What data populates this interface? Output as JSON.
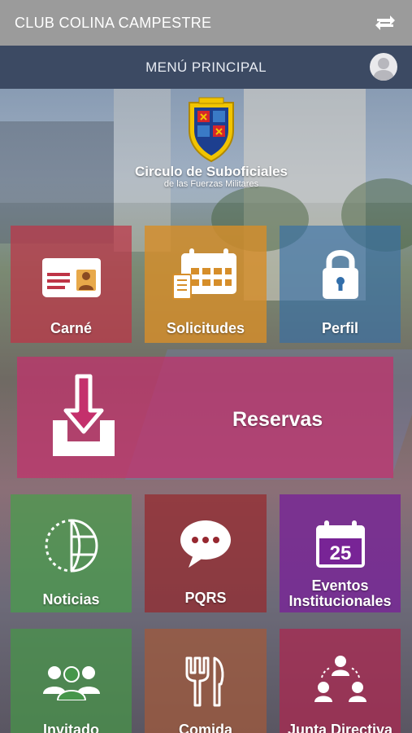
{
  "appbar": {
    "title": "CLUB COLINA CAMPESTRE",
    "refresh_icon": "refresh-icon"
  },
  "menubar": {
    "title": "MENÚ PRINCIPAL",
    "avatar_icon": "user-avatar-icon"
  },
  "logo": {
    "line1": "Circulo de Suboficiales",
    "line2": "de las Fuerzas Militares"
  },
  "tiles": {
    "carne": {
      "label": "Carné",
      "icon": "id-card-icon"
    },
    "solicitudes": {
      "label": "Solicitudes",
      "icon": "calendar-form-icon"
    },
    "perfil": {
      "label": "Perfil",
      "icon": "lock-icon"
    },
    "reservas": {
      "label": "Reservas",
      "icon": "download-tray-icon"
    },
    "noticias": {
      "label": "Noticias",
      "icon": "globe-icon"
    },
    "pqrs": {
      "label": "PQRS",
      "icon": "chat-bubble-icon"
    },
    "eventos": {
      "label_line1": "Eventos",
      "label_line2": "Institucionales",
      "icon": "calendar-icon",
      "calendar_day": "25"
    },
    "invitado": {
      "label": "Invitado",
      "icon": "group-icon"
    },
    "comida": {
      "label": "Comida",
      "icon": "cutlery-icon"
    },
    "junta": {
      "label": "Junta Directiva",
      "icon": "org-chart-icon"
    }
  },
  "colors": {
    "appbar": "#9b9b9b",
    "menubar": "#3c4a63",
    "solicitudes": "#d68e2a",
    "eventos": "#782496"
  }
}
